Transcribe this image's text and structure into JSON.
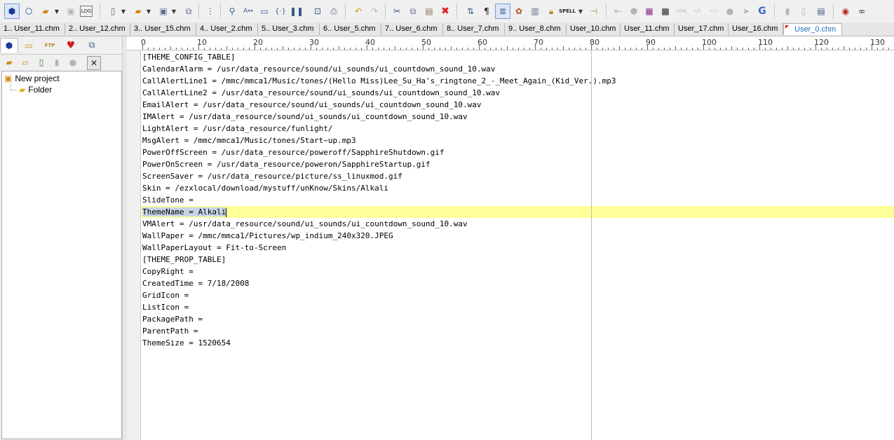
{
  "toolbar": {
    "icons": [
      "new-project",
      "open-project",
      "open-project-dropdown",
      "close-project",
      "log",
      "new-file",
      "open-file",
      "save",
      "save-all",
      "tree-view",
      "find",
      "replace",
      "goto",
      "bracket-match",
      "bookmarks",
      "find-in-files",
      "print",
      "undo",
      "redo",
      "cut",
      "copy",
      "paste",
      "delete",
      "sort",
      "show-paragraph",
      "word-wrap",
      "color-picker",
      "column-mode",
      "lock",
      "spell-check",
      "pin",
      "outdent",
      "circle",
      "color-table",
      "color-table-10",
      "html-text",
      "tag-off",
      "tag-on",
      "circle-2",
      "send",
      "google",
      "doc-1",
      "doc-2",
      "doc-3",
      "macro-record",
      "glasses"
    ],
    "spell_label": "SPELL"
  },
  "tabs": [
    "1.. User_11.chm",
    "2.. User_12.chm",
    "3.. User_15.chm",
    "4.. User_2.chm",
    "5.. User_3.chm",
    "6.. User_5.chm",
    "7.. User_6.chm",
    "8.. User_7.chm",
    "9.. User_8.chm",
    "User_10.chm",
    "User_11.chm",
    "User_17.chm",
    "User_16.chm",
    "User_0.chm"
  ],
  "active_tab_index": 13,
  "left_panel": {
    "tabs": [
      "project",
      "file-explorer",
      "ftp",
      "favorites",
      "windows"
    ],
    "tree": {
      "root": "New project",
      "child": "Folder"
    }
  },
  "ruler": {
    "marks": [
      "0",
      "10",
      "20",
      "30",
      "40",
      "50",
      "60",
      "70",
      "80",
      "90",
      "100",
      "110",
      "120",
      "130"
    ]
  },
  "editor": {
    "current_line_index": 13,
    "current_line_selected": "ThemeName = Alkali",
    "lines": [
      "[THEME_CONFIG_TABLE]",
      "CalendarAlarm = /usr/data_resource/sound/ui_sounds/ui_countdown_sound_10.wav",
      "CallAlertLine1 = /mmc/mmca1/Music/tones/(Hello Miss)Lee_Su_Ha's_ringtone_2_-_Meet_Again_(Kid_Ver.).mp3",
      "CallAlertLine2 = /usr/data_resource/sound/ui_sounds/ui_countdown_sound_10.wav",
      "EmailAlert = /usr/data_resource/sound/ui_sounds/ui_countdown_sound_10.wav",
      "IMAlert = /usr/data_resource/sound/ui_sounds/ui_countdown_sound_10.wav",
      "LightAlert = /usr/data_resource/funlight/",
      "MsgAlert = /mmc/mmca1/Music/tones/Start~up.mp3",
      "PowerOffScreen = /usr/data_resource/poweroff/SapphireShutdown.gif",
      "PowerOnScreen = /usr/data_resource/poweron/SapphireStartup.gif",
      "ScreenSaver = /usr/data_resource/picture/ss_linuxmod.gif",
      "Skin = /ezxlocal/download/mystuff/unKnow/Skins/Alkali",
      "SlideTone =",
      "ThemeName = Alkali",
      "VMAlert = /usr/data_resource/sound/ui_sounds/ui_countdown_sound_10.wav",
      "WallPaper = /mmc/mmca1/Pictures/wp_indium_240x320.JPEG",
      "WallPaperLayout = Fit-to-Screen",
      "[THEME_PROP_TABLE]",
      "CopyRight =",
      "CreatedTime = 7/18/2008",
      "GridIcon =",
      "ListIcon =",
      "PackagePath =",
      "ParentPath =",
      "ThemeSize = 1520654"
    ]
  }
}
